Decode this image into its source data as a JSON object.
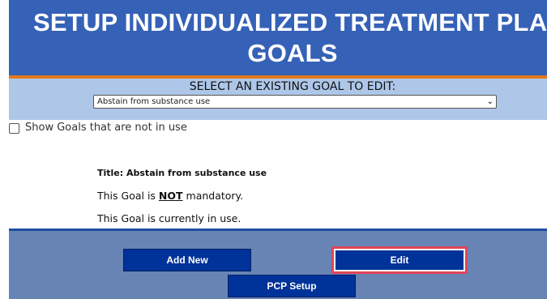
{
  "header": {
    "title_line1": "SETUP INDIVIDUALIZED TREATMENT PLAN",
    "title_line2": "GOALS"
  },
  "select_section": {
    "label": "SELECT AN EXISTING GOAL TO EDIT:",
    "selected_goal": "Abstain from substance use"
  },
  "filter": {
    "show_unused_label": "Show Goals that are not in use",
    "checked": false
  },
  "goal_details": {
    "title_prefix": "Title: ",
    "title_value": "Abstain from substance use",
    "mandatory_prefix": "This Goal is ",
    "mandatory_not": "NOT",
    "mandatory_suffix": " mandatory.",
    "in_use_text": "This Goal is currently in use."
  },
  "actions": {
    "add_new": "Add New",
    "edit": "Edit",
    "pcp_setup": "PCP Setup"
  },
  "colors": {
    "header_bg": "#3561b7",
    "accent_orange": "#e07a1f",
    "button_bg": "#003399",
    "highlight": "#e0445a"
  }
}
